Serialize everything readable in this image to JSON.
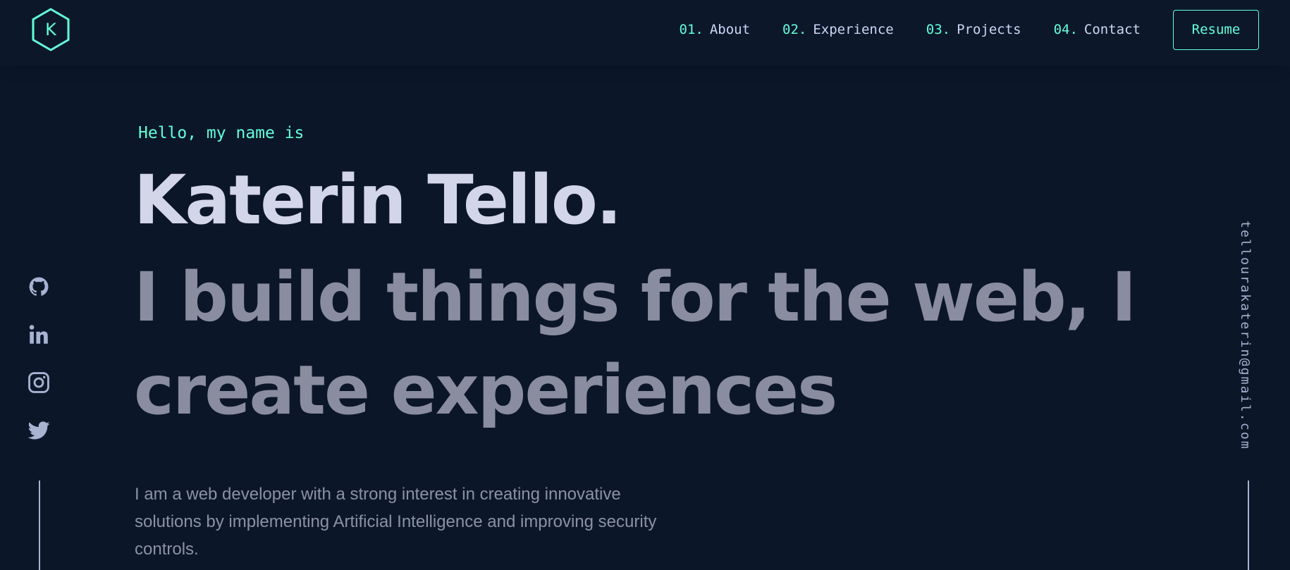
{
  "header": {
    "logo": {
      "letter": "K",
      "icon": "hexagon-logo-icon",
      "color": "#64ffda"
    },
    "nav": [
      {
        "number": "01.",
        "label": "About"
      },
      {
        "number": "02.",
        "label": "Experience"
      },
      {
        "number": "03.",
        "label": "Projects"
      },
      {
        "number": "04.",
        "label": "Contact"
      }
    ],
    "resume_label": "Resume"
  },
  "hero": {
    "greeting": "Hello, my name is",
    "name": "Katerin Tello.",
    "tagline_line1": "I build things for the web, I",
    "tagline_line2": "create experiences",
    "intro": "I am a web developer with a strong interest in creating innovative solutions by implementing Artificial Intelligence and improving security controls."
  },
  "social": [
    {
      "icon": "github-icon"
    },
    {
      "icon": "linkedin-icon"
    },
    {
      "icon": "instagram-icon"
    },
    {
      "icon": "twitter-icon"
    }
  ],
  "email": "tellourakaterin@gmail.com",
  "colors": {
    "background": "#0b1729",
    "accent": "#64ffda",
    "name": "#d3d6e8",
    "tagline": "#8a8d9f",
    "body_text": "#8c91a6",
    "icon": "#a8b2d1"
  }
}
